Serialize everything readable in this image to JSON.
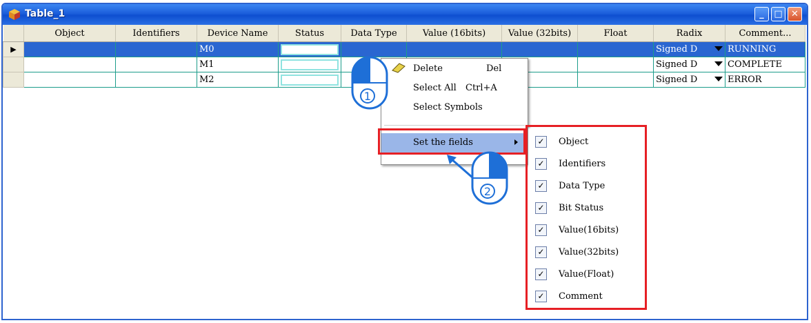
{
  "window": {
    "title": "Table_1"
  },
  "columns": [
    "Object",
    "Identifiers",
    "Device Name",
    "Status",
    "Data Type",
    "Value (16bits)",
    "Value (32bits)",
    "Float",
    "Radix",
    "Comment..."
  ],
  "rows": [
    {
      "device": "M0",
      "radix": "Signed D",
      "comment": "RUNNING"
    },
    {
      "device": "M1",
      "radix": "Signed D",
      "comment": "COMPLETE"
    },
    {
      "device": "M2",
      "radix": "Signed D",
      "comment": "ERROR"
    }
  ],
  "context_menu": {
    "items": [
      {
        "label": "Delete",
        "shortcut": "Del"
      },
      {
        "label": "Select All",
        "shortcut": "Ctrl+A"
      },
      {
        "label": "Select Symbols",
        "shortcut": ""
      },
      {
        "label": "Set the fields",
        "shortcut": ""
      }
    ]
  },
  "fields_submenu": {
    "items": [
      "Object",
      "Identifiers",
      "Data Type",
      "Bit Status",
      "Value(16bits)",
      "Value(32bits)",
      "Value(Float)",
      "Comment"
    ]
  },
  "markers": {
    "step1": "1",
    "step2": "2"
  },
  "colors": {
    "selection": "#2a66d1",
    "highlight_box": "#e61f24",
    "titlebar": "#1b5edb"
  }
}
